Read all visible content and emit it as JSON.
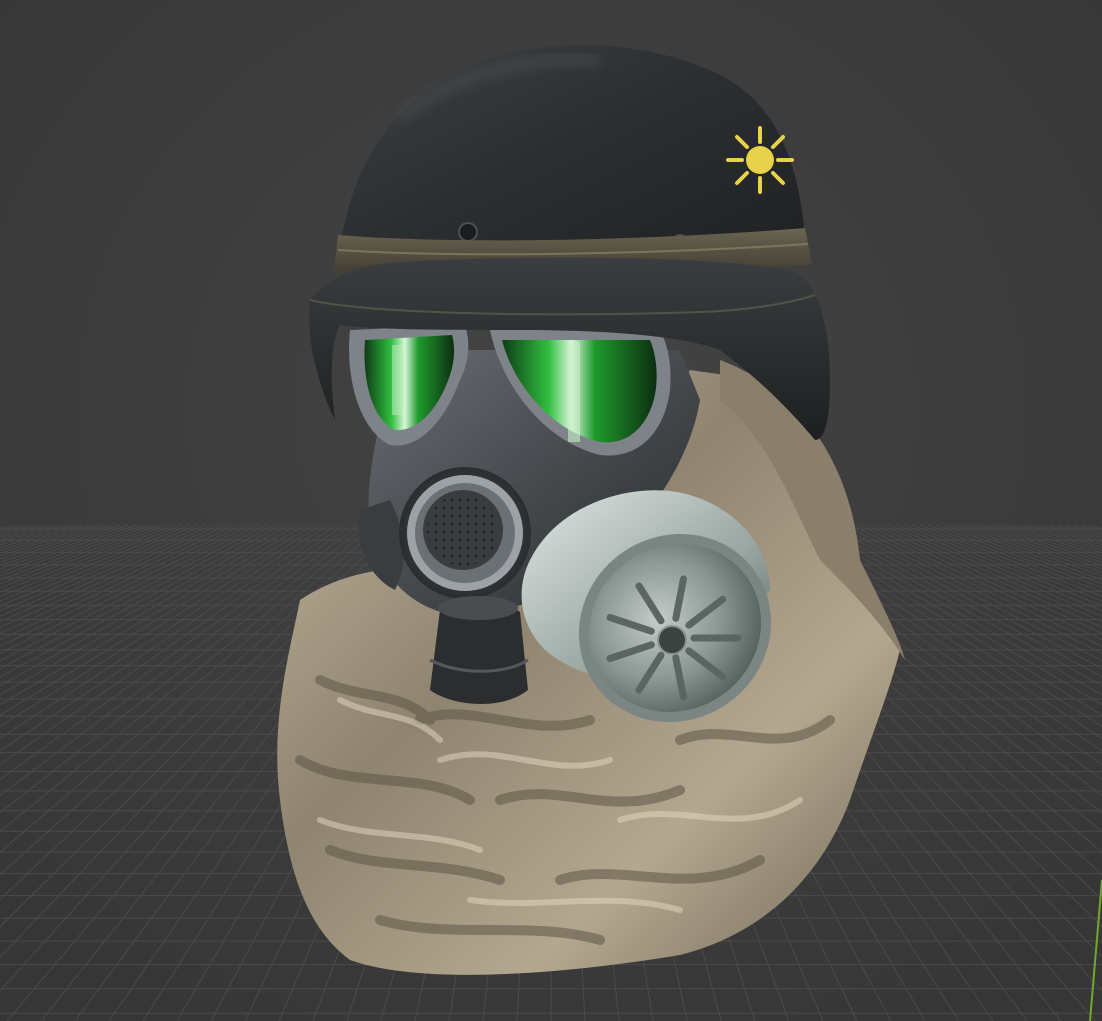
{
  "viewport": {
    "kind": "3d-viewport",
    "background_color": "#3c3c3c",
    "grid_color": "#4a4a4a",
    "axis_color": "#6fa82a",
    "object": {
      "name_icon": "gas-mask-helmet-model",
      "parts": [
        "helmet",
        "helmet-badge",
        "goggles",
        "gas-mask",
        "exhalation-valve",
        "voice-emitter",
        "filter-canister",
        "cloth-hood"
      ],
      "colors": {
        "helmet": "#2f3234",
        "helmet_band": "#5a5547",
        "lens": "#1f8a2e",
        "mask": "#4a4d52",
        "canister": "#9aa6a2",
        "cloth": "#a99c85",
        "badge": "#e8d24a"
      }
    }
  }
}
